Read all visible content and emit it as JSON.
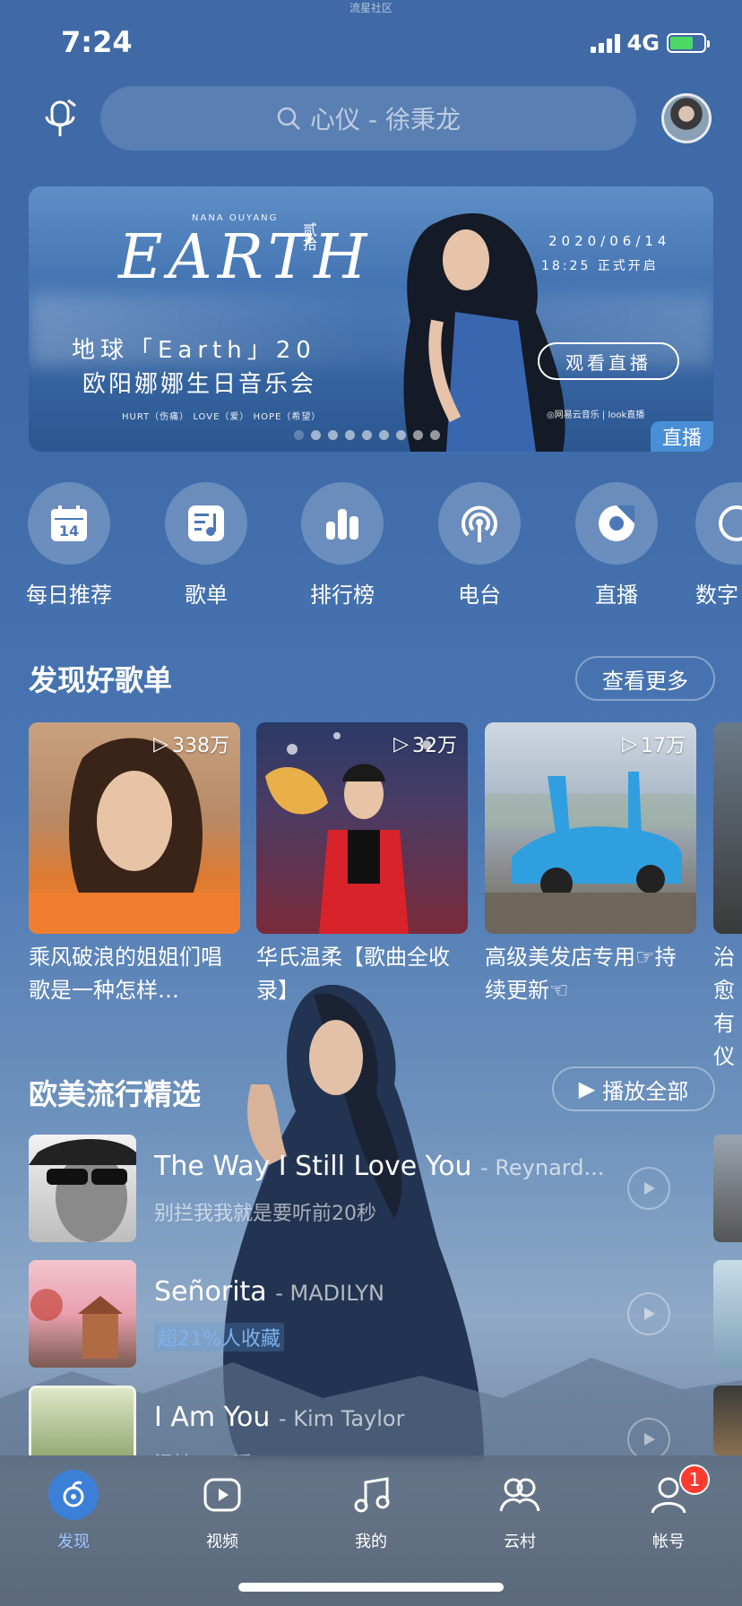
{
  "status": {
    "top_label": "流星社区",
    "time": "7:24",
    "network": "4G"
  },
  "search": {
    "placeholder": "心仪 - 徐秉龙"
  },
  "banner": {
    "artist": "NANA OUYANG",
    "logo_title": "EARTH",
    "logo_number": "贰拾",
    "line1": "地球「Earth」20",
    "line2": "欧阳娜娜生日音乐会",
    "line3": "HURT（伤痛） LOVE（爱） HOPE（希望）",
    "date": "2020/06/14",
    "start": "18:25 正式开启",
    "watch_label": "观看直播",
    "logos": "◎网易云音乐 | look直播",
    "tag": "直播"
  },
  "quick": [
    {
      "label": "每日推荐",
      "icon": "calendar-icon",
      "day": "14"
    },
    {
      "label": "歌单",
      "icon": "playlist-icon"
    },
    {
      "label": "排行榜",
      "icon": "chart-icon"
    },
    {
      "label": "电台",
      "icon": "radio-icon"
    },
    {
      "label": "直播",
      "icon": "live-icon"
    },
    {
      "label": "数字",
      "icon": "digital-album-icon"
    }
  ],
  "playlists_section": {
    "title": "发现好歌单",
    "more": "查看更多"
  },
  "playlists": [
    {
      "count": "338万",
      "name": "乘风破浪的姐姐们唱歌是一种怎样…"
    },
    {
      "count": "32万",
      "name": "华氏温柔【歌曲全收录】"
    },
    {
      "count": "17万",
      "name": "高级美发店专用☞持续更新☜"
    },
    {
      "count": "",
      "name": "治愈有仪"
    }
  ],
  "songs_section": {
    "title": "欧美流行精选",
    "play_all": "播放全部"
  },
  "songs": [
    {
      "title": "The Way I Still Love You",
      "artist": "- Reynard...",
      "sub": "别拦我我就是要听前20秒"
    },
    {
      "title": "Señorita",
      "artist": "- MADILYN",
      "sub": "超21%人收藏"
    },
    {
      "title": "I Am You",
      "artist": "- Kim Taylor",
      "sub": "温情 / 一瞬"
    }
  ],
  "tabs": [
    {
      "label": "发现",
      "icon": "discover-icon"
    },
    {
      "label": "视频",
      "icon": "video-icon"
    },
    {
      "label": "我的",
      "icon": "music-note-icon"
    },
    {
      "label": "云村",
      "icon": "community-icon"
    },
    {
      "label": "帐号",
      "icon": "account-icon",
      "badge": "1"
    }
  ]
}
